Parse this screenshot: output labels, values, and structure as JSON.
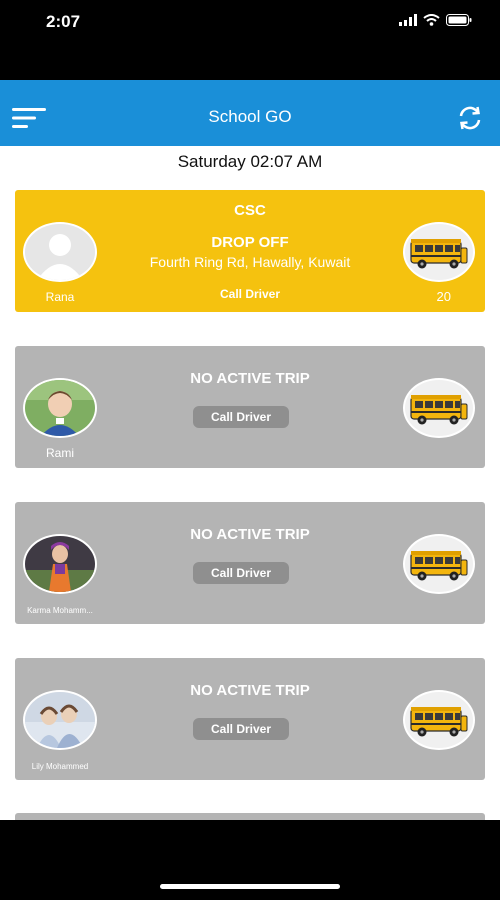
{
  "status_bar": {
    "time": "2:07",
    "icons": [
      "signal-icon",
      "wifi-icon",
      "battery-icon"
    ]
  },
  "header": {
    "title": "School GO",
    "left_icon": "menu-icon",
    "right_icon": "refresh-icon",
    "color": "#1a8fd8"
  },
  "date": "Saturday 02:07 AM",
  "colors": {
    "active_card": "#f5c20f",
    "inactive_card": "#b4b4b4",
    "pill": "#8f8f8f"
  },
  "cards": [
    {
      "name": "Rana",
      "school": "CSC",
      "status": "DROP OFF",
      "address": "Fourth Ring Rd, Hawally, Kuwait",
      "call_label": "Call Driver",
      "count": "20"
    },
    {
      "name": "Rami",
      "status": "NO ACTIVE TRIP",
      "call_label": "Call Driver"
    },
    {
      "name": "Karma Mohamm...",
      "status": "NO ACTIVE TRIP",
      "call_label": "Call Driver"
    },
    {
      "name": "Lily Mohammed",
      "status": "NO ACTIVE TRIP",
      "call_label": "Call Driver"
    }
  ]
}
